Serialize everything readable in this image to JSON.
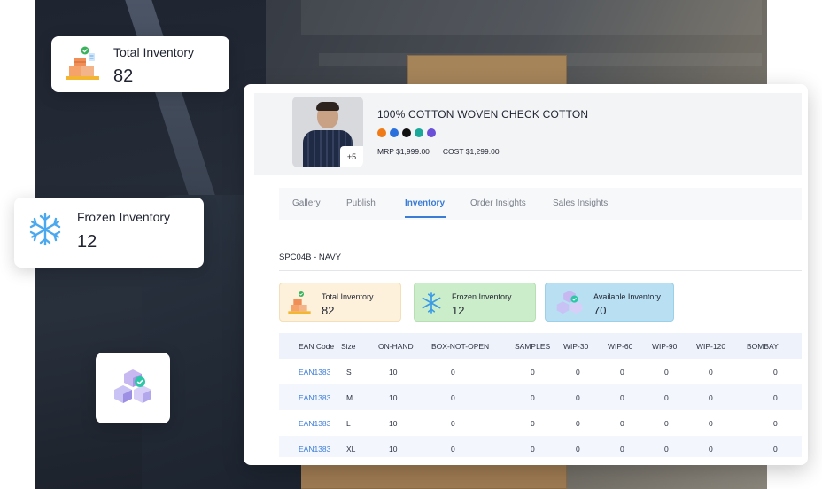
{
  "floating_cards": {
    "total_inventory": {
      "label": "Total Inventory",
      "value": "82"
    },
    "frozen_inventory": {
      "label": "Frozen Inventory",
      "value": "12"
    }
  },
  "product": {
    "title": "100% COTTON WOVEN CHECK COTTON",
    "more_images": "+5",
    "colors": [
      "#f07a16",
      "#2a6fdb",
      "#111111",
      "#19a89a",
      "#6a4fd8"
    ],
    "mrp": "MRP $1,999.00",
    "cost": "COST $1,299.00"
  },
  "tabs": [
    {
      "label": "Gallery"
    },
    {
      "label": "Publish"
    },
    {
      "label": "Inventory"
    },
    {
      "label": "Order Insights"
    },
    {
      "label": "Sales Insights"
    }
  ],
  "variant": "SPC04B - NAVY",
  "stats": {
    "total": {
      "label": "Total Inventory",
      "value": "82"
    },
    "frozen": {
      "label": "Frozen Inventory",
      "value": "12"
    },
    "available": {
      "label": "Available Inventory",
      "value": "70"
    }
  },
  "table": {
    "headers": [
      "EAN Code",
      "Size",
      "ON-HAND",
      "BOX-NOT-OPEN",
      "SAMPLES",
      "WIP-30",
      "WIP-60",
      "WIP-90",
      "WIP-120",
      "BOMBAY"
    ],
    "rows": [
      [
        "EAN1383",
        "S",
        "10",
        "0",
        "0",
        "0",
        "0",
        "0",
        "0",
        "0"
      ],
      [
        "EAN1383",
        "M",
        "10",
        "0",
        "0",
        "0",
        "0",
        "0",
        "0",
        "0"
      ],
      [
        "EAN1383",
        "L",
        "10",
        "0",
        "0",
        "0",
        "0",
        "0",
        "0",
        "0"
      ],
      [
        "EAN1383",
        "XL",
        "10",
        "0",
        "0",
        "0",
        "0",
        "0",
        "0",
        "0"
      ]
    ]
  }
}
